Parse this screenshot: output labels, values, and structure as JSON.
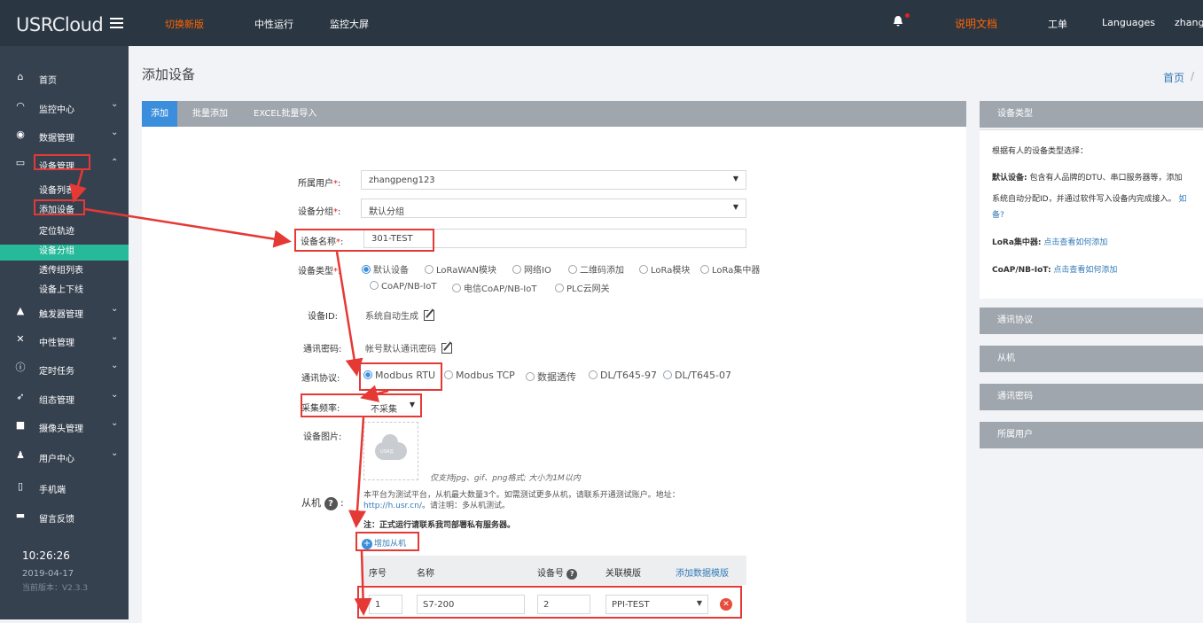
{
  "topbar": {
    "logo_usr": "USR",
    "logo_cloud": "Cloud",
    "nav": [
      "切换新版",
      "中性运行",
      "监控大屏"
    ],
    "doc_link": "说明文档",
    "ticket": "工单",
    "languages": "Languages",
    "user": "zhang",
    "accent": "#ff6600"
  },
  "sidebar": {
    "items": [
      {
        "label": "首页",
        "icon": "home-icon"
      },
      {
        "label": "监控中心",
        "icon": "gauge-icon"
      },
      {
        "label": "数据管理",
        "icon": "target-icon"
      },
      {
        "label": "设备管理",
        "icon": "monitor-icon"
      },
      {
        "label": "触发器管理",
        "icon": "bell-icon"
      },
      {
        "label": "中性管理",
        "icon": "wrench-icon"
      },
      {
        "label": "定时任务",
        "icon": "clock-icon"
      },
      {
        "label": "组态管理",
        "icon": "send-icon"
      },
      {
        "label": "摄像头管理",
        "icon": "camera-icon"
      },
      {
        "label": "用户中心",
        "icon": "users-icon"
      },
      {
        "label": "手机端",
        "icon": "mobile-icon"
      },
      {
        "label": "留言反馈",
        "icon": "comment-icon"
      }
    ],
    "sub_items": [
      "设备列表",
      "添加设备",
      "定位轨迹",
      "设备分组",
      "透传组列表",
      "设备上下线"
    ],
    "time": "10:26:26",
    "date": "2019-04-17",
    "version": "当前版本：V2.3.3"
  },
  "page": {
    "title": "添加设备",
    "breadcrumb_home": "首页",
    "breadcrumb_sep": "/"
  },
  "tabs": [
    "添加",
    "批量添加",
    "EXCEL批量导入"
  ],
  "form": {
    "owner_label": "所属用户",
    "owner_value": "zhangpeng123",
    "group_label": "设备分组",
    "group_value": "默认分组",
    "name_label": "设备名称",
    "name_value": "301-TEST",
    "type_label": "设备类型",
    "type_options": [
      "默认设备",
      "LoRaWAN模块",
      "网络IO",
      "二维码添加",
      "LoRa模块",
      "LoRa集中器",
      "CoAP/NB-IoT",
      "电信CoAP/NB-IoT",
      "PLC云网关"
    ],
    "id_label": "设备ID:",
    "id_value": "系统自动生成",
    "pwd_label": "通讯密码:",
    "pwd_value": "帐号默认通讯密码",
    "protocol_label": "通讯协议:",
    "protocol_options": [
      "Modbus RTU",
      "Modbus TCP",
      "数据透传",
      "DL/T645-97",
      "DL/T645-07"
    ],
    "freq_label": "采集频率:",
    "freq_value": "不采集",
    "image_label": "设备图片:",
    "image_hint": "仅支持jpg、gif、png格式; 大小为1M以内",
    "upload_text": "USR云",
    "slave_label": "从机",
    "slave_note_1": "本平台为测试平台，从机最大数量3个。如需测试更多从机，请联系开通测试账户。地址：",
    "slave_note_link": "http://h.usr.cn/",
    "slave_note_2": "。请注明：多从机测试。",
    "slave_note_3": "注：正式运行请联系我司部署私有服务器。",
    "add_slave": "增加从机"
  },
  "slave_table": {
    "headers": [
      "序号",
      "名称",
      "设备号",
      "关联模版",
      "添加数据模版"
    ],
    "row": {
      "index": "1",
      "name": "S7-200",
      "device_no": "2",
      "template": "PPI-TEST"
    }
  },
  "right_panel": {
    "title": "设备类型",
    "intro": "根据有人的设备类型选择：",
    "default_title": "默认设备:",
    "default_text_1": "包含有人品牌的DTU、串口服务器等，添加",
    "default_text_2": "系统自动分配ID，并通过软件写入设备内完成接入。",
    "default_link_1": "如",
    "default_link_2": "备?",
    "lora_title": "LoRa集中器:",
    "lora_link": "点击查看如何添加",
    "coap_title": "CoAP/NB-IoT:",
    "coap_link": "点击查看如何添加",
    "sections": [
      "通讯协议",
      "从机",
      "通讯密码",
      "所属用户"
    ]
  }
}
